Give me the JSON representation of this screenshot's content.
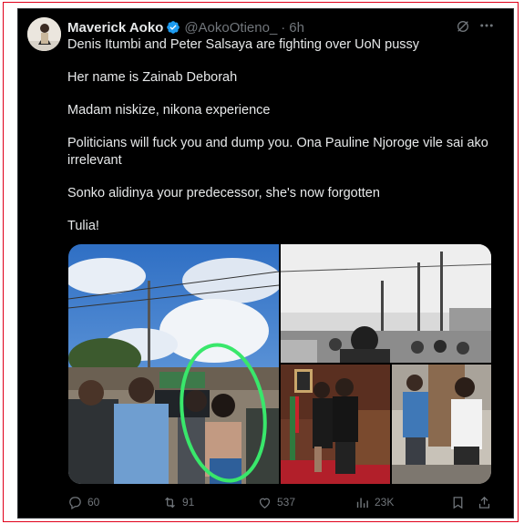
{
  "post": {
    "author_name": "Maverick Aoko",
    "handle": "@AokoOtieno_",
    "separator": "·",
    "time": "6h",
    "paragraphs": [
      "Denis Itumbi and Peter Salsaya are fighting over UoN pussy",
      "Her name is Zainab Deborah",
      "Madam niskize, nikona experience",
      "Politicians will fuck you and dump you. Ona Pauline Njoroge vile sai ako irrelevant",
      "Sonko alidinya your predecessor, she's now forgotten",
      "Tulia!"
    ]
  },
  "metrics": {
    "replies": "60",
    "reposts": "91",
    "likes": "537",
    "views": "23K"
  },
  "icons": {
    "verified": "verified-badge-icon",
    "grok": "grok-icon",
    "more": "more-options-icon",
    "reply": "reply-icon",
    "repost": "repost-icon",
    "like": "like-icon",
    "views": "views-icon",
    "bookmark": "bookmark-icon",
    "share": "share-icon"
  },
  "colors": {
    "background": "#000000",
    "text": "#e7e9ea",
    "muted": "#71767b",
    "verified": "#1d9bf0",
    "annotation": "#39e76b",
    "outer_border": "#e0001a"
  }
}
